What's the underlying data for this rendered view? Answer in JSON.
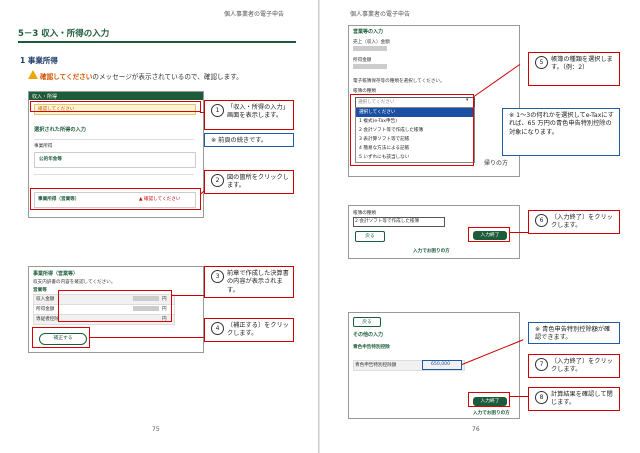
{
  "left": {
    "running_head": "個人事業者の電子申告",
    "section_title": "5－3 収入・所得の入力",
    "subsection": "1 事業所得",
    "warning_highlight": "確認してください",
    "warning_text": "のメッセージが表示されているので、確認します。",
    "shot1": {
      "bar": "収入・所得",
      "warn1": "確認してください",
      "heading": "選択された所得の入力",
      "row1": "事業所得",
      "row1b": "公的年金等",
      "row2_label": "事業所得（営業等）",
      "row2_warn": "▲ 確認してください"
    },
    "shot2": {
      "bar": "事業所得（営業等）",
      "caption": "収支内訳書の内容を確認してください。",
      "sub": "営業等",
      "rows": [
        "収入金額",
        "所得金額",
        "専従者控除"
      ],
      "unit": "円",
      "button": "補正する"
    },
    "callouts": {
      "c1_num": "1",
      "c1": "「収入・所得の入力」画面を表示します。",
      "c_note": "※ 前頁の続きです。",
      "c2_num": "2",
      "c2": "図の箇所をクリックします。",
      "c3_num": "3",
      "c3": "前章で作成した決算書の内容が表示されます。",
      "c4_num": "4",
      "c4": "〔補正する〕をクリックします。"
    },
    "page_number": "75"
  },
  "right": {
    "running_head": "個人事業者の電子申告",
    "shot3": {
      "bar": "営業等の入力",
      "l1": "売上（収入）金額",
      "l2": "所得金額",
      "l3": "電子帳簿保存等の種類を選択してください。",
      "l4": "帳簿の種類",
      "select_placeholder": "選択してください",
      "options": [
        "選択してください",
        "1 複式(e-Tax申告)",
        "2 会計ソフト等で作成した帳簿",
        "3 表計算ソフト等で記帳",
        "4 簡易な方法による記帳",
        "5 いずれにも該当しない"
      ],
      "tail": "帰りの方"
    },
    "shot4": {
      "label": "帳簿の種類",
      "value": "2 会計ソフト等で作成した帳簿",
      "back": "戻る",
      "done": "入力終了",
      "link": "入力でお困りの方"
    },
    "shot5": {
      "back_top": "戻る",
      "heading": "その他の入力",
      "row_a": "青色申告特別控除",
      "row_b": "青色申告特別控除額",
      "value": "650,000",
      "done": "入力終了",
      "link": "入力でお困りの方"
    },
    "callouts": {
      "c5_num": "5",
      "c5": "帳簿の種類を選択します。（例：2）",
      "note1": "※ 1～3の何れかを選択してe-Taxにすれば、65 万円の青色申告特別控除の対象になります。",
      "c6_num": "6",
      "c6": "〔入力終了〕をクリックします。",
      "note2": "※ 青色申告特別控除額が確認できます。",
      "c7_num": "7",
      "c7": "〔入力終了〕をクリックします。",
      "c8_num": "8",
      "c8": "計算結果を確認して閉じます。"
    },
    "page_number": "76"
  },
  "colors": {
    "accent_green": "#1d5c3a",
    "callout_red": "#c00000",
    "note_blue": "#1e5aa8",
    "warning_orange": "#d35400"
  }
}
